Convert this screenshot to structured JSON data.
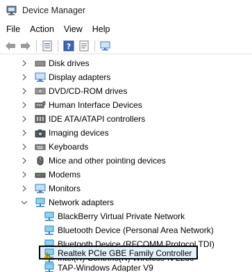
{
  "window": {
    "title": "Device Manager"
  },
  "menu": [
    "File",
    "Action",
    "View",
    "Help"
  ],
  "toolbar": {
    "icons": [
      "back-arrow-icon",
      "forward-arrow-icon",
      "properties-icon",
      "help-icon",
      "monitor-icon"
    ]
  },
  "tree": {
    "categories": [
      "Disk drives",
      "Display adapters",
      "DVD/CD-ROM drives",
      "Human Interface Devices",
      "IDE ATA/ATAPI controllers",
      "Imaging devices",
      "Keyboards",
      "Mice and other pointing devices",
      "Modems",
      "Monitors",
      "Network adapters"
    ],
    "network_children": [
      "BlackBerry Virtual Private Network",
      "Bluetooth Device (Personal Area Network)",
      "Bluetooth Device (RFCOMM Protocol TDI)",
      "Intel(R) Centrino(R) Wireless-N 2230",
      "Realtek PCIe GBE Family Controller",
      "TAP-Windows Adapter V9"
    ],
    "selected": "Realtek PCIe GBE Family Controller"
  }
}
